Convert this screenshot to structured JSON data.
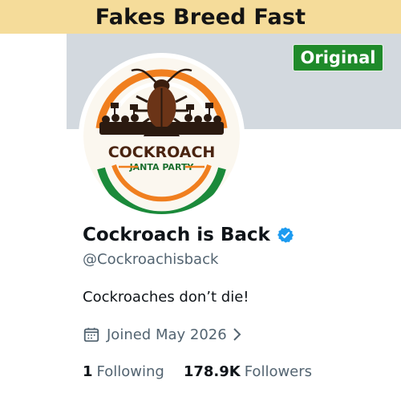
{
  "banner": {
    "title": "Fakes Breed Fast"
  },
  "badge": {
    "label": "Original",
    "color": "#1f8a2a"
  },
  "avatar": {
    "logo_line1": "COCKROACH",
    "logo_line2": "JANTA PARTY",
    "colors": {
      "saffron": "#f07f1f",
      "green": "#1b8a3a",
      "brown": "#5a2a12"
    }
  },
  "profile": {
    "display_name": "Cockroach is Back",
    "verified_icon": "verified-badge-icon",
    "verified_color": "#1d9bf0",
    "handle": "@Cockroachisback",
    "bio": "Cockroaches don’t die!",
    "joined": "Joined May 2026",
    "joined_icon": "calendar-icon",
    "following_count": "1",
    "following_label": "Following",
    "followers_count": "178.9K",
    "followers_label": "Followers"
  }
}
